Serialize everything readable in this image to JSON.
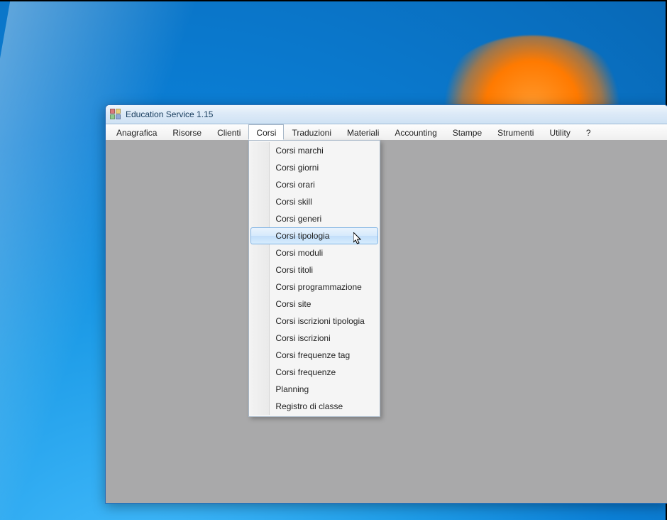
{
  "window": {
    "title": "Education Service 1.15"
  },
  "menubar": {
    "items": [
      "Anagrafica",
      "Risorse",
      "Clienti",
      "Corsi",
      "Traduzioni",
      "Materiali",
      "Accounting",
      "Stampe",
      "Strumenti",
      "Utility",
      "?"
    ],
    "open_index": 3
  },
  "dropdown": {
    "items": [
      "Corsi marchi",
      "Corsi giorni",
      "Corsi orari",
      "Corsi skill",
      "Corsi generi",
      "Corsi tipologia",
      "Corsi moduli",
      "Corsi titoli",
      "Corsi programmazione",
      "Corsi site",
      "Corsi iscrizioni tipologia",
      "Corsi iscrizioni",
      "Corsi frequenze tag",
      "Corsi frequenze",
      "Planning",
      "Registro di classe"
    ],
    "hover_index": 5
  }
}
